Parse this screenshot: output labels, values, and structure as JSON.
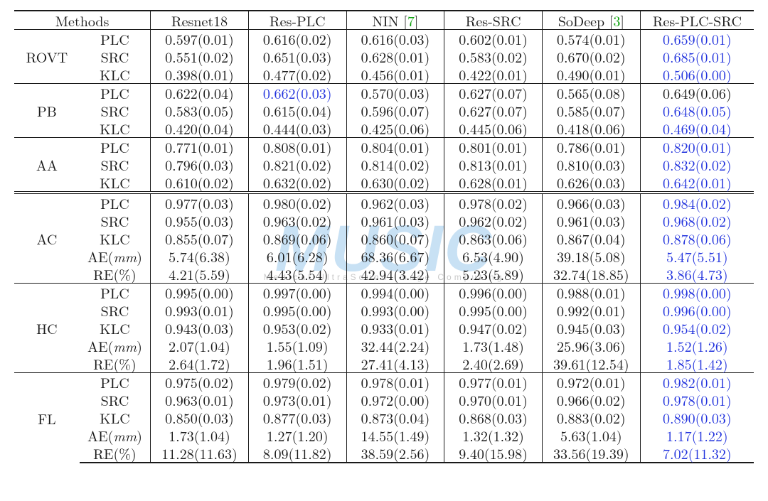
{
  "watermark": {
    "main": "MUSIC",
    "sub": "Medical UltraSound Image Computing"
  },
  "columns": {
    "methods": "Methods",
    "resnet18": "Resnet18",
    "resplc": "Res-PLC",
    "nin_pre": "NIN [",
    "nin_ref": "7",
    "nin_post": "]",
    "ressrc": "Res-SRC",
    "sodeep_pre": "SoDeep [",
    "sodeep_ref": "3",
    "sodeep_post": "]",
    "resplcsrc": "Res-PLC-SRC"
  },
  "metric_labels": {
    "PLC": "PLC",
    "SRC": "SRC",
    "KLC": "KLC",
    "AE_pre": "AE(",
    "AE_unit": "mm",
    "AE_post": ")",
    "RE": "RE(%)"
  },
  "groups": [
    {
      "name": "ROVT",
      "rows": [
        {
          "metric": "PLC",
          "cells": [
            {
              "v": "0.597(0.01)"
            },
            {
              "v": "0.616(0.02)"
            },
            {
              "v": "0.616(0.03)"
            },
            {
              "v": "0.602(0.01)"
            },
            {
              "v": "0.574(0.01)"
            },
            {
              "v": "0.659(0.01)",
              "hl": true
            }
          ]
        },
        {
          "metric": "SRC",
          "cells": [
            {
              "v": "0.551(0.02)"
            },
            {
              "v": "0.651(0.03)"
            },
            {
              "v": "0.628(0.01)"
            },
            {
              "v": "0.583(0.02)"
            },
            {
              "v": "0.670(0.02)"
            },
            {
              "v": "0.685(0.01)",
              "hl": true
            }
          ]
        },
        {
          "metric": "KLC",
          "cells": [
            {
              "v": "0.398(0.01)"
            },
            {
              "v": "0.477(0.02)"
            },
            {
              "v": "0.456(0.01)"
            },
            {
              "v": "0.422(0.01)"
            },
            {
              "v": "0.490(0.01)"
            },
            {
              "v": "0.506(0.00)",
              "hl": true
            }
          ]
        }
      ]
    },
    {
      "name": "PB",
      "rows": [
        {
          "metric": "PLC",
          "cells": [
            {
              "v": "0.622(0.04)"
            },
            {
              "v": "0.662(0.03)",
              "hl": true
            },
            {
              "v": "0.570(0.03)"
            },
            {
              "v": "0.627(0.07)"
            },
            {
              "v": "0.565(0.08)"
            },
            {
              "v": "0.649(0.06)"
            }
          ]
        },
        {
          "metric": "SRC",
          "cells": [
            {
              "v": "0.583(0.05)"
            },
            {
              "v": "0.615(0.04)"
            },
            {
              "v": "0.596(0.07)"
            },
            {
              "v": "0.627(0.07)"
            },
            {
              "v": "0.585(0.07)"
            },
            {
              "v": "0.648(0.05)",
              "hl": true
            }
          ]
        },
        {
          "metric": "KLC",
          "cells": [
            {
              "v": "0.420(0.04)"
            },
            {
              "v": "0.444(0.03)"
            },
            {
              "v": "0.425(0.06)"
            },
            {
              "v": "0.445(0.06)"
            },
            {
              "v": "0.418(0.06)"
            },
            {
              "v": "0.469(0.04)",
              "hl": true
            }
          ]
        }
      ]
    },
    {
      "name": "AA",
      "rows": [
        {
          "metric": "PLC",
          "cells": [
            {
              "v": "0.771(0.01)"
            },
            {
              "v": "0.808(0.01)"
            },
            {
              "v": "0.804(0.01)"
            },
            {
              "v": "0.801(0.01)"
            },
            {
              "v": "0.786(0.01)"
            },
            {
              "v": "0.820(0.01)",
              "hl": true
            }
          ]
        },
        {
          "metric": "SRC",
          "cells": [
            {
              "v": "0.796(0.03)"
            },
            {
              "v": "0.821(0.02)"
            },
            {
              "v": "0.814(0.02)"
            },
            {
              "v": "0.813(0.01)"
            },
            {
              "v": "0.810(0.03)"
            },
            {
              "v": "0.832(0.02)",
              "hl": true
            }
          ]
        },
        {
          "metric": "KLC",
          "cells": [
            {
              "v": "0.610(0.02)"
            },
            {
              "v": "0.632(0.02)"
            },
            {
              "v": "0.630(0.02)"
            },
            {
              "v": "0.628(0.01)"
            },
            {
              "v": "0.626(0.03)"
            },
            {
              "v": "0.642(0.01)",
              "hl": true
            }
          ]
        }
      ]
    },
    {
      "name": "AC",
      "rows": [
        {
          "metric": "PLC",
          "cells": [
            {
              "v": "0.977(0.03)"
            },
            {
              "v": "0.980(0.02)"
            },
            {
              "v": "0.962(0.03)"
            },
            {
              "v": "0.978(0.02)"
            },
            {
              "v": "0.966(0.03)"
            },
            {
              "v": "0.984(0.02)",
              "hl": true
            }
          ]
        },
        {
          "metric": "SRC",
          "cells": [
            {
              "v": "0.955(0.03)"
            },
            {
              "v": "0.963(0.02)"
            },
            {
              "v": "0.961(0.03)"
            },
            {
              "v": "0.962(0.02)"
            },
            {
              "v": "0.961(0.03)"
            },
            {
              "v": "0.968(0.02)",
              "hl": true
            }
          ]
        },
        {
          "metric": "KLC",
          "cells": [
            {
              "v": "0.855(0.07)"
            },
            {
              "v": "0.869(0.06)"
            },
            {
              "v": "0.860(0.07)"
            },
            {
              "v": "0.863(0.06)"
            },
            {
              "v": "0.867(0.04)"
            },
            {
              "v": "0.878(0.06)",
              "hl": true
            }
          ]
        },
        {
          "metric": "AE",
          "cells": [
            {
              "v": "5.74(6.38)"
            },
            {
              "v": "6.01(6.28)"
            },
            {
              "v": "68.36(6.67)"
            },
            {
              "v": "6.53(4.90)"
            },
            {
              "v": "39.18(5.08)"
            },
            {
              "v": "5.47(5.51)",
              "hl": true
            }
          ]
        },
        {
          "metric": "RE",
          "cells": [
            {
              "v": "4.21(5.59)"
            },
            {
              "v": "4.43(5.54)"
            },
            {
              "v": "42.94(3.42)"
            },
            {
              "v": "5.23(5.89)"
            },
            {
              "v": "32.74(18.85)"
            },
            {
              "v": "3.86(4.73)",
              "hl": true
            }
          ]
        }
      ]
    },
    {
      "name": "HC",
      "rows": [
        {
          "metric": "PLC",
          "cells": [
            {
              "v": "0.995(0.00)"
            },
            {
              "v": "0.997(0.00)"
            },
            {
              "v": "0.994(0.00)"
            },
            {
              "v": "0.996(0.00)"
            },
            {
              "v": "0.988(0.01)"
            },
            {
              "v": "0.998(0.00)",
              "hl": true
            }
          ]
        },
        {
          "metric": "SRC",
          "cells": [
            {
              "v": "0.993(0.01)"
            },
            {
              "v": "0.995(0.00)"
            },
            {
              "v": "0.993(0.00)"
            },
            {
              "v": "0.995(0.00)"
            },
            {
              "v": "0.992(0.01)"
            },
            {
              "v": "0.996(0.00)",
              "hl": true
            }
          ]
        },
        {
          "metric": "KLC",
          "cells": [
            {
              "v": "0.943(0.03)"
            },
            {
              "v": "0.953(0.02)"
            },
            {
              "v": "0.933(0.01)"
            },
            {
              "v": "0.947(0.02)"
            },
            {
              "v": "0.945(0.03)"
            },
            {
              "v": "0.954(0.02)",
              "hl": true
            }
          ]
        },
        {
          "metric": "AE",
          "cells": [
            {
              "v": "2.07(1.04)"
            },
            {
              "v": "1.55(1.09)"
            },
            {
              "v": "32.44(2.24)"
            },
            {
              "v": "1.73(1.48)"
            },
            {
              "v": "25.96(3.06)"
            },
            {
              "v": "1.52(1.26)",
              "hl": true
            }
          ]
        },
        {
          "metric": "RE",
          "cells": [
            {
              "v": "2.64(1.72)"
            },
            {
              "v": "1.96(1.51)"
            },
            {
              "v": "27.41(4.13)"
            },
            {
              "v": "2.40(2.69)"
            },
            {
              "v": "39.61(12.54)"
            },
            {
              "v": "1.85(1.42)",
              "hl": true
            }
          ]
        }
      ]
    },
    {
      "name": "FL",
      "rows": [
        {
          "metric": "PLC",
          "cells": [
            {
              "v": "0.975(0.02)"
            },
            {
              "v": "0.979(0.02)"
            },
            {
              "v": "0.978(0.01)"
            },
            {
              "v": "0.977(0.01)"
            },
            {
              "v": "0.972(0.01)"
            },
            {
              "v": "0.982(0.01)",
              "hl": true
            }
          ]
        },
        {
          "metric": "SRC",
          "cells": [
            {
              "v": "0.963(0.01)"
            },
            {
              "v": "0.973(0.01)"
            },
            {
              "v": "0.972(0.00)"
            },
            {
              "v": "0.970(0.01)"
            },
            {
              "v": "0.966(0.02)"
            },
            {
              "v": "0.978(0.01)",
              "hl": true
            }
          ]
        },
        {
          "metric": "KLC",
          "cells": [
            {
              "v": "0.850(0.03)"
            },
            {
              "v": "0.877(0.03)"
            },
            {
              "v": "0.873(0.04)"
            },
            {
              "v": "0.868(0.03)"
            },
            {
              "v": "0.883(0.02)"
            },
            {
              "v": "0.890(0.03)",
              "hl": true
            }
          ]
        },
        {
          "metric": "AE",
          "cells": [
            {
              "v": "1.73(1.04)"
            },
            {
              "v": "1.27(1.20)"
            },
            {
              "v": "14.55(1.49)"
            },
            {
              "v": "1.32(1.32)"
            },
            {
              "v": "5.63(1.04)"
            },
            {
              "v": "1.17(1.22)",
              "hl": true
            }
          ]
        },
        {
          "metric": "RE",
          "cells": [
            {
              "v": "11.28(11.63)"
            },
            {
              "v": "8.09(11.82)"
            },
            {
              "v": "38.59(2.56)"
            },
            {
              "v": "9.40(15.98)"
            },
            {
              "v": "33.56(19.39)"
            },
            {
              "v": "7.02(11.32)",
              "hl": true
            }
          ]
        }
      ]
    }
  ]
}
